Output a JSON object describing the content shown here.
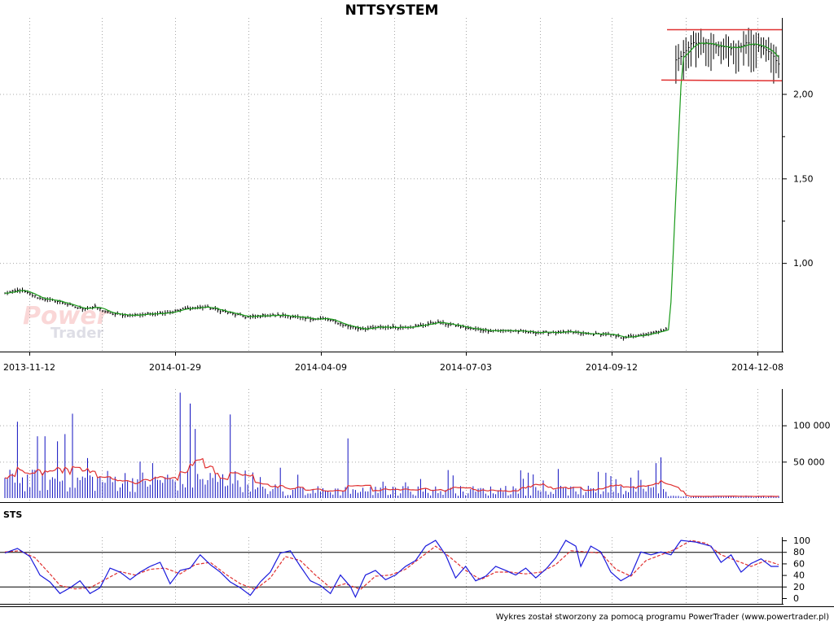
{
  "title": "NTTSYSTEM",
  "footer": "Wykres został stworzony za pomocą programu PowerTrader (www.powertrader.pl)",
  "watermark": {
    "line1": "Power",
    "line2": "Trader"
  },
  "colors": {
    "price_bar": "#000000",
    "price_ma": "#1a9a1a",
    "channel": "#e03030",
    "volume_bar": "#1010c0",
    "volume_ma": "#e03030",
    "sts_k": "#1a1adc",
    "sts_d": "#e03030",
    "grid": "#a8a8a8"
  },
  "chart_data": [
    {
      "type": "bar",
      "panel": "price",
      "x_labels": [
        "2013-11-12",
        "2014-01-29",
        "2014-04-09",
        "2014-07-03",
        "2014-09-12",
        "2014-12-08"
      ],
      "y_ticks": [
        "2,00",
        "1,50",
        "1,00"
      ],
      "ylim": [
        0.5,
        2.45
      ],
      "channel": {
        "upper": 2.38,
        "lower": 2.08
      },
      "anchors": [
        [
          0,
          0.82
        ],
        [
          6,
          0.84
        ],
        [
          14,
          0.79
        ],
        [
          22,
          0.77
        ],
        [
          30,
          0.73
        ],
        [
          36,
          0.74
        ],
        [
          42,
          0.7
        ],
        [
          50,
          0.69
        ],
        [
          58,
          0.7
        ],
        [
          66,
          0.71
        ],
        [
          72,
          0.73
        ],
        [
          80,
          0.74
        ],
        [
          88,
          0.71
        ],
        [
          96,
          0.68
        ],
        [
          104,
          0.69
        ],
        [
          112,
          0.69
        ],
        [
          120,
          0.67
        ],
        [
          128,
          0.67
        ],
        [
          136,
          0.63
        ],
        [
          142,
          0.61
        ],
        [
          150,
          0.62
        ],
        [
          158,
          0.62
        ],
        [
          166,
          0.63
        ],
        [
          172,
          0.65
        ],
        [
          180,
          0.63
        ],
        [
          186,
          0.61
        ],
        [
          194,
          0.6
        ],
        [
          202,
          0.6
        ],
        [
          210,
          0.59
        ],
        [
          218,
          0.59
        ],
        [
          226,
          0.59
        ],
        [
          232,
          0.58
        ],
        [
          240,
          0.58
        ],
        [
          246,
          0.56
        ],
        [
          254,
          0.57
        ],
        [
          260,
          0.59
        ],
        [
          265,
          0.62
        ],
        [
          267,
          2.2
        ],
        [
          270,
          2.22
        ],
        [
          274,
          2.3
        ],
        [
          280,
          2.3
        ],
        [
          286,
          2.28
        ],
        [
          292,
          2.27
        ],
        [
          296,
          2.3
        ],
        [
          302,
          2.28
        ],
        [
          306,
          2.24
        ],
        [
          309,
          2.18
        ]
      ]
    },
    {
      "type": "bar",
      "panel": "volume",
      "y_ticks": [
        "100 000",
        "50 000"
      ],
      "ylim": [
        0,
        150000
      ],
      "spikes": [
        [
          5,
          105000
        ],
        [
          13,
          85000
        ],
        [
          16,
          85000
        ],
        [
          21,
          78000
        ],
        [
          24,
          88000
        ],
        [
          27,
          116000
        ],
        [
          33,
          55000
        ],
        [
          54,
          50000
        ],
        [
          59,
          48000
        ],
        [
          70,
          145000
        ],
        [
          74,
          130000
        ],
        [
          76,
          95000
        ],
        [
          90,
          115000
        ],
        [
          137,
          82000
        ],
        [
          260,
          48000
        ],
        [
          262,
          56000
        ]
      ]
    },
    {
      "type": "line",
      "panel": "sts",
      "label": "STS",
      "y_ticks": [
        "100",
        "80",
        "60",
        "40",
        "20",
        "0"
      ],
      "ylim": [
        0,
        100
      ],
      "levels": [
        80,
        20
      ],
      "series": [
        {
          "anchors": [
            [
              0,
              78
            ],
            [
              5,
              86
            ],
            [
              10,
              72
            ],
            [
              14,
              40
            ],
            [
              18,
              28
            ],
            [
              22,
              8
            ],
            [
              26,
              18
            ],
            [
              30,
              30
            ],
            [
              34,
              8
            ],
            [
              38,
              18
            ],
            [
              42,
              52
            ],
            [
              46,
              45
            ],
            [
              50,
              32
            ],
            [
              54,
              45
            ],
            [
              58,
              55
            ],
            [
              62,
              62
            ],
            [
              66,
              25
            ],
            [
              70,
              48
            ],
            [
              74,
              52
            ],
            [
              78,
              75
            ],
            [
              82,
              58
            ],
            [
              86,
              45
            ],
            [
              90,
              28
            ],
            [
              94,
              18
            ],
            [
              98,
              5
            ],
            [
              102,
              28
            ],
            [
              106,
              45
            ],
            [
              110,
              78
            ],
            [
              114,
              82
            ],
            [
              118,
              55
            ],
            [
              122,
              30
            ],
            [
              126,
              22
            ],
            [
              130,
              8
            ],
            [
              134,
              40
            ],
            [
              138,
              20
            ],
            [
              140,
              2
            ],
            [
              144,
              40
            ],
            [
              148,
              48
            ],
            [
              152,
              32
            ],
            [
              156,
              40
            ],
            [
              160,
              55
            ],
            [
              164,
              65
            ],
            [
              168,
              90
            ],
            [
              172,
              100
            ],
            [
              176,
              75
            ],
            [
              180,
              35
            ],
            [
              184,
              55
            ],
            [
              188,
              30
            ],
            [
              192,
              38
            ],
            [
              196,
              55
            ],
            [
              200,
              48
            ],
            [
              204,
              40
            ],
            [
              208,
              52
            ],
            [
              212,
              35
            ],
            [
              216,
              50
            ],
            [
              220,
              70
            ],
            [
              224,
              100
            ],
            [
              228,
              90
            ],
            [
              230,
              55
            ],
            [
              234,
              90
            ],
            [
              238,
              80
            ],
            [
              242,
              45
            ],
            [
              246,
              30
            ],
            [
              250,
              40
            ],
            [
              254,
              80
            ],
            [
              258,
              75
            ],
            [
              262,
              80
            ],
            [
              266,
              75
            ],
            [
              270,
              100
            ],
            [
              276,
              97
            ],
            [
              282,
              90
            ],
            [
              286,
              62
            ],
            [
              290,
              75
            ],
            [
              294,
              45
            ],
            [
              298,
              60
            ],
            [
              302,
              68
            ],
            [
              306,
              55
            ],
            [
              309,
              55
            ]
          ]
        },
        {
          "anchors": [
            [
              0,
              80
            ],
            [
              6,
              82
            ],
            [
              12,
              70
            ],
            [
              18,
              42
            ],
            [
              22,
              22
            ],
            [
              28,
              16
            ],
            [
              34,
              18
            ],
            [
              40,
              32
            ],
            [
              46,
              46
            ],
            [
              52,
              40
            ],
            [
              58,
              50
            ],
            [
              64,
              52
            ],
            [
              70,
              42
            ],
            [
              76,
              58
            ],
            [
              82,
              62
            ],
            [
              88,
              42
            ],
            [
              94,
              25
            ],
            [
              100,
              15
            ],
            [
              106,
              35
            ],
            [
              112,
              72
            ],
            [
              118,
              65
            ],
            [
              124,
              40
            ],
            [
              130,
              18
            ],
            [
              136,
              25
            ],
            [
              142,
              15
            ],
            [
              148,
              38
            ],
            [
              154,
              40
            ],
            [
              160,
              50
            ],
            [
              166,
              70
            ],
            [
              172,
              90
            ],
            [
              178,
              70
            ],
            [
              184,
              48
            ],
            [
              190,
              32
            ],
            [
              196,
              45
            ],
            [
              202,
              45
            ],
            [
              208,
              42
            ],
            [
              214,
              45
            ],
            [
              220,
              58
            ],
            [
              226,
              82
            ],
            [
              232,
              80
            ],
            [
              238,
              78
            ],
            [
              244,
              50
            ],
            [
              250,
              38
            ],
            [
              256,
              65
            ],
            [
              262,
              75
            ],
            [
              268,
              85
            ],
            [
              274,
              100
            ],
            [
              280,
              95
            ],
            [
              286,
              75
            ],
            [
              292,
              65
            ],
            [
              298,
              55
            ],
            [
              304,
              65
            ],
            [
              309,
              58
            ]
          ]
        }
      ]
    }
  ]
}
